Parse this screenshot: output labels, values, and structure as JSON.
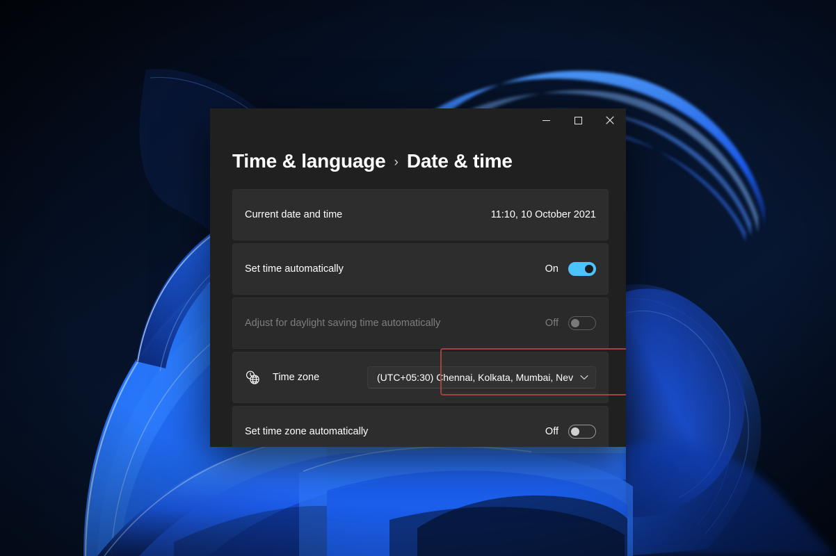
{
  "desktop": {
    "wallpaper_name": "windows-11-bloom-wallpaper",
    "background_color": "#040b1c"
  },
  "window": {
    "titlebar": {
      "minimize_label": "Minimize",
      "maximize_label": "Maximize",
      "close_label": "Close",
      "minimize_icon": "minimize-icon",
      "maximize_icon": "maximize-icon",
      "close_icon": "close-icon"
    },
    "breadcrumb": {
      "parent": "Time & language",
      "separator": "›",
      "current": "Date & time"
    },
    "settings": [
      {
        "name": "current-date-and-time",
        "label": "Current date and time",
        "value": "11:10, 10 October 2021",
        "control": "text",
        "disabled": false
      },
      {
        "name": "set-time-automatically",
        "label": "Set time automatically",
        "state": "On",
        "control": "toggle",
        "toggle_on": true,
        "disabled": false,
        "highlighted": true
      },
      {
        "name": "adjust-for-daylight-saving-time-automatically",
        "label": "Adjust for daylight saving time automatically",
        "state": "Off",
        "control": "toggle",
        "toggle_on": false,
        "disabled": true
      },
      {
        "name": "time-zone",
        "label": "Time zone",
        "icon": "time-zone-globe-clock-icon",
        "control": "dropdown",
        "selected": "(UTC+05:30) Chennai, Kolkata, Mumbai, Nev",
        "chevron_icon": "chevron-down-icon",
        "disabled": false
      },
      {
        "name": "set-time-zone-automatically",
        "label": "Set time zone automatically",
        "state": "Off",
        "control": "toggle",
        "toggle_on": false,
        "disabled": false
      }
    ],
    "colors": {
      "window_background": "#202020",
      "card_background": "#2d2d2d",
      "toggle_accent": "#4cc2ff",
      "highlight_border": "#a24245",
      "text_primary": "#ffffff",
      "text_disabled": "#7e7e7e"
    }
  },
  "annotation": {
    "highlight_target": "set-time-automatically",
    "highlight_color": "#a24245"
  }
}
